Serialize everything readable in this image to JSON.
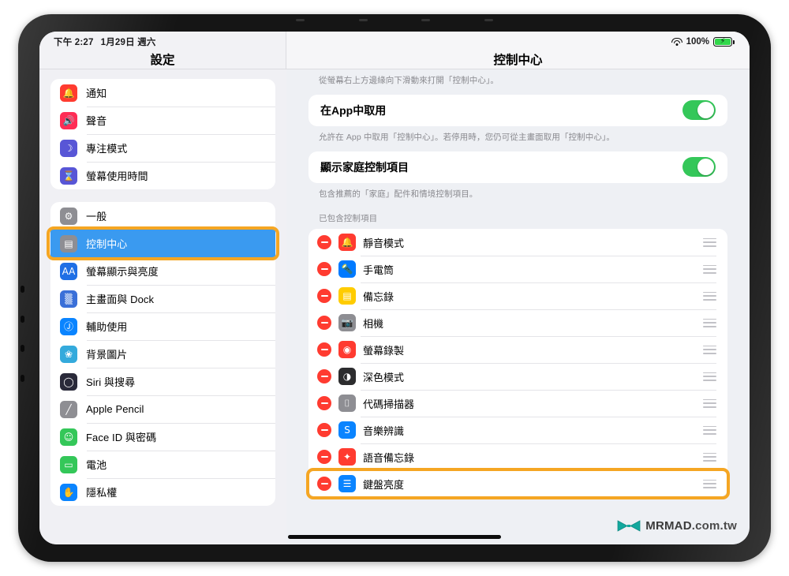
{
  "status_bar": {
    "time": "下午 2:27",
    "date": "1月29日 週六",
    "wifi_icon": "wifi-icon",
    "battery_percent": "100%",
    "battery_icon": "battery-charging-icon"
  },
  "sidebar": {
    "title": "設定",
    "groups": [
      {
        "items": [
          {
            "label": "通知",
            "icon": "notifications-icon",
            "icon_bg": "#ff3b30",
            "glyph": "🔔",
            "selected": false
          },
          {
            "label": "聲音",
            "icon": "sounds-icon",
            "icon_bg": "#ff2d55",
            "glyph": "🔊",
            "selected": false
          },
          {
            "label": "專注模式",
            "icon": "focus-icon",
            "icon_bg": "#5856d6",
            "glyph": "☽",
            "selected": false
          },
          {
            "label": "螢幕使用時間",
            "icon": "screen-time-icon",
            "icon_bg": "#5856d6",
            "glyph": "⌛",
            "selected": false
          }
        ]
      },
      {
        "items": [
          {
            "label": "一般",
            "icon": "general-gear-icon",
            "icon_bg": "#8e8e93",
            "glyph": "⚙",
            "selected": false
          },
          {
            "label": "控制中心",
            "icon": "control-center-icon",
            "icon_bg": "#8e8e93",
            "glyph": "▤",
            "selected": true
          },
          {
            "label": "螢幕顯示與亮度",
            "icon": "display-brightness-icon",
            "icon_bg": "#1f6fe5",
            "glyph": "AA",
            "selected": false
          },
          {
            "label": "主畫面與 Dock",
            "icon": "home-screen-dock-icon",
            "icon_bg": "#3a6fd8",
            "glyph": "▒",
            "selected": false
          },
          {
            "label": "輔助使用",
            "icon": "accessibility-icon",
            "icon_bg": "#0a84ff",
            "glyph": "Ⓙ",
            "selected": false
          },
          {
            "label": "背景圖片",
            "icon": "wallpaper-icon",
            "icon_bg": "#34aadc",
            "glyph": "❀",
            "selected": false
          },
          {
            "label": "Siri 與搜尋",
            "icon": "siri-search-icon",
            "icon_bg": "#2a2a3a",
            "glyph": "◯",
            "selected": false
          },
          {
            "label": "Apple Pencil",
            "icon": "apple-pencil-icon",
            "icon_bg": "#8e8e93",
            "glyph": "╱",
            "selected": false
          },
          {
            "label": "Face ID 與密碼",
            "icon": "face-id-icon",
            "icon_bg": "#34c759",
            "glyph": "☺",
            "selected": false
          },
          {
            "label": "電池",
            "icon": "battery-settings-icon",
            "icon_bg": "#34c759",
            "glyph": "▭",
            "selected": false
          },
          {
            "label": "隱私權",
            "icon": "privacy-icon",
            "icon_bg": "#0a84ff",
            "glyph": "✋",
            "selected": false
          }
        ]
      }
    ]
  },
  "detail": {
    "title": "控制中心",
    "intro_note": "從螢幕右上方邊緣向下滑動來打開「控制中心」。",
    "settings": [
      {
        "label": "在App中取用",
        "toggle_on": true,
        "footnote": "允許在 App 中取用「控制中心」。若停用時，您仍可從主畫面取用「控制中心」。"
      },
      {
        "label": "顯示家庭控制項目",
        "toggle_on": true,
        "footnote": "包含推薦的「家庭」配件和情境控制項目。"
      }
    ],
    "included_header": "已包含控制項目",
    "included_controls": [
      {
        "label": "靜音模式",
        "icon": "silent-mode-icon",
        "icon_bg": "#ff3b30",
        "glyph": "🔔",
        "highlighted": false
      },
      {
        "label": "手電筒",
        "icon": "flashlight-icon",
        "icon_bg": "#007aff",
        "glyph": "🔦",
        "highlighted": false
      },
      {
        "label": "備忘錄",
        "icon": "notes-icon",
        "icon_bg": "#ffcc00",
        "glyph": "▤",
        "highlighted": false
      },
      {
        "label": "相機",
        "icon": "camera-icon",
        "icon_bg": "#8e8e93",
        "glyph": "📷",
        "highlighted": false
      },
      {
        "label": "螢幕錄製",
        "icon": "screen-recording-icon",
        "icon_bg": "#ff3b30",
        "glyph": "◉",
        "highlighted": false
      },
      {
        "label": "深色模式",
        "icon": "dark-mode-icon",
        "icon_bg": "#2c2c2e",
        "glyph": "◑",
        "highlighted": false
      },
      {
        "label": "代碼掃描器",
        "icon": "code-scanner-icon",
        "icon_bg": "#8e8e93",
        "glyph": "⌷",
        "highlighted": false
      },
      {
        "label": "音樂辨識",
        "icon": "shazam-icon",
        "icon_bg": "#0a84ff",
        "glyph": "S",
        "highlighted": false
      },
      {
        "label": "語音備忘錄",
        "icon": "voice-memos-icon",
        "icon_bg": "#ff3b30",
        "glyph": "✦",
        "highlighted": false
      },
      {
        "label": "鍵盤亮度",
        "icon": "keyboard-brightness-icon",
        "icon_bg": "#0a84ff",
        "glyph": "☰",
        "highlighted": true
      }
    ],
    "remove_button_name": "remove-control-button",
    "reorder_handle_name": "reorder-drag-handle"
  },
  "annotations": {
    "highlight_color": "#f5a623",
    "highlight_sidebar_item": "控制中心",
    "highlight_control_item": "鍵盤亮度"
  },
  "watermark": {
    "brand": "MRMAD",
    "tld": ".com.tw",
    "logo_icon": "mrmad-bowtie-logo",
    "logo_color": "#13a89e",
    "logo_accent": "#f5c518"
  }
}
